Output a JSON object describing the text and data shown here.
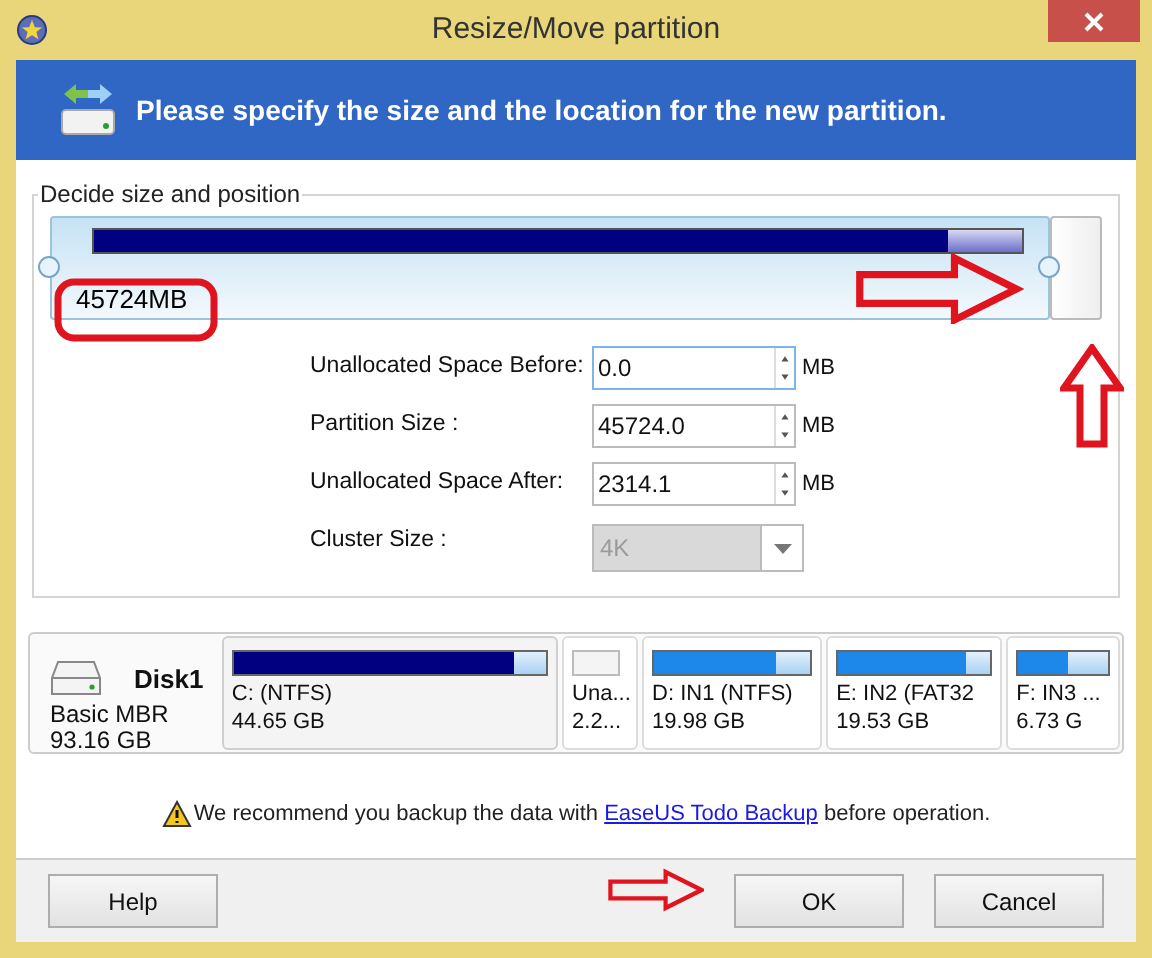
{
  "window": {
    "title": "Resize/Move partition"
  },
  "header": {
    "text": "Please specify the size and the location for the new partition."
  },
  "group": {
    "title": "Decide size and position",
    "partition": {
      "label": "45724MB"
    },
    "usage": {
      "level": 0.92
    }
  },
  "fields": [
    {
      "kind": "spin",
      "label": "Unallocated Space Before:",
      "value": "0.0",
      "unit": "MB",
      "focused": true
    },
    {
      "kind": "spin",
      "label": "Partition Size :",
      "value": "45724.0",
      "unit": "MB",
      "focused": false
    },
    {
      "kind": "spin",
      "label": "Unallocated Space After:",
      "value": "2314.1",
      "unit": "MB",
      "focused": false
    },
    {
      "kind": "combo",
      "label": "Cluster Size :",
      "value": "4K",
      "disabled": true
    }
  ],
  "disk": {
    "name": "Disk1",
    "type": "Basic MBR",
    "size": "93.16 GB"
  },
  "partitions": [
    {
      "name": "C: (NTFS)",
      "size": "44.65 GB",
      "level": 0.9,
      "selected": true,
      "kind": "used"
    },
    {
      "name": "Una...",
      "size": "2.2...",
      "selected": false,
      "kind": "free"
    },
    {
      "name": "D: IN1 (NTFS)",
      "size": "19.98 GB",
      "level": 0.78,
      "selected": false,
      "kind": "used"
    },
    {
      "name": "E: IN2 (FAT32",
      "size": "19.53 GB",
      "level": 0.84,
      "selected": false,
      "kind": "used"
    },
    {
      "name": "F: IN3 ...",
      "size": "6.73 G",
      "level": 0.55,
      "selected": false,
      "kind": "used"
    }
  ],
  "notice": {
    "before": "We recommend you backup the data with",
    "link": "EaseUS Todo Backup",
    "after": "before operation."
  },
  "buttons": [
    {
      "label": "Help"
    },
    {
      "label": "OK"
    },
    {
      "label": "Cancel"
    }
  ]
}
